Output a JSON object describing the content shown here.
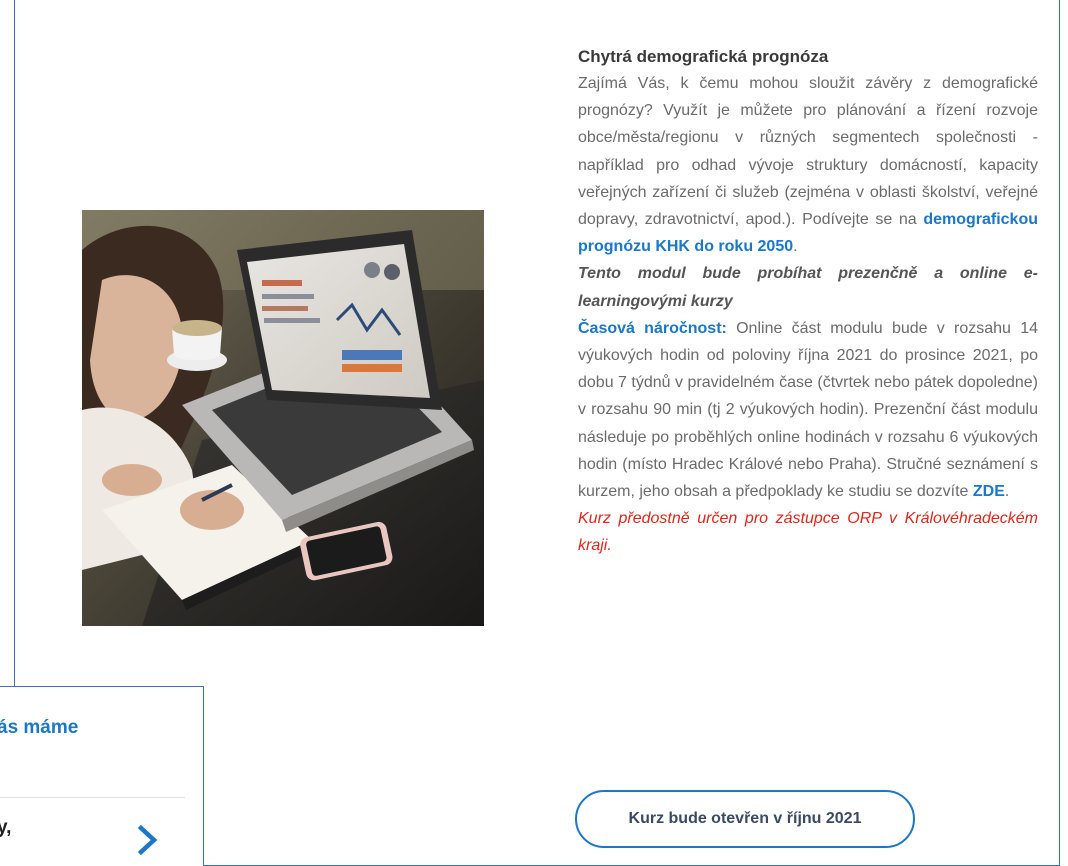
{
  "content": {
    "title": "Chytrá demografická prognóza",
    "intro": "Zajímá Vás, k čemu mohou sloužit závěry z demografické prognózy? Využít je můžete pro plánování a řízení rozvoje obce/města/regionu v různých segmentech společnosti - například pro odhad vývoje struktury domácností, kapacity veřejných zařízení či služeb (zejména v oblasti školství, veřejné dopravy, zdravotnictví, apod.). Podívejte se na ",
    "prognosis_link": "demografickou prognózu KHK do roku 2050",
    "intro_end": ".",
    "module_note": "Tento modul bude probíhat prezenčně a online e-learningovými kurzy",
    "time_label": "Časová náročnost:",
    "time_text": " Online část modulu bude v rozsahu 14 výukových hodin od poloviny října 2021 do prosince 2021, po dobu 7 týdnů v pravidelném čase (čtvrtek nebo pátek dopoledne) v rozsahu 90 min (tj 2 výukových hodin). Prezenční část modulu následuje po proběhlých online hodinách v rozsahu 6 výukových hodin (místo Hradec Králové nebo Praha). Stručné seznámení s kurzem, jeho obsah a předpoklady ke studiu se dozvíte ",
    "details_link": "ZDE",
    "details_end": ".",
    "target_note": "Kurz předostně určen pro zástupce ORP v Královéhradeckém kraji."
  },
  "course_button": {
    "label": "Kurz bude otevřen v říjnu 2021"
  },
  "popup": {
    "title": "ás máme",
    "text": "y,",
    "chevron_icon": "chevron-right-icon"
  },
  "photo": {
    "icon": "laptop-photo"
  },
  "colors": {
    "accent": "#1a77c9",
    "frame": "#3b6fc2",
    "warning": "#e2251b",
    "body_text": "#6b6b6b"
  }
}
